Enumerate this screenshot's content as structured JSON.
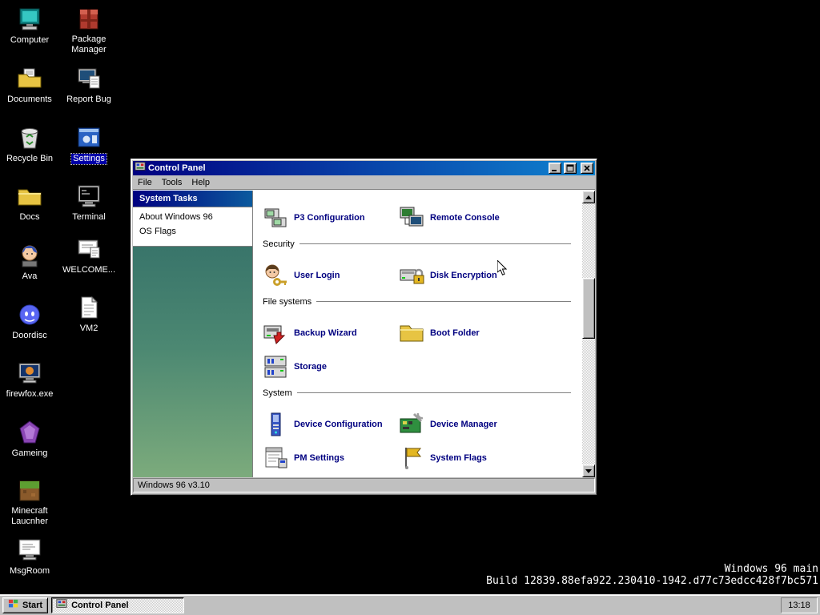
{
  "desktop": {
    "col1": [
      {
        "label": "Computer"
      },
      {
        "label": "Documents"
      },
      {
        "label": "Recycle Bin"
      },
      {
        "label": "Docs"
      },
      {
        "label": "Ava"
      },
      {
        "label": "Doordisc"
      },
      {
        "label": "firewfox.exe"
      },
      {
        "label": "Gameing"
      },
      {
        "label": "Minecraft Laucnher"
      },
      {
        "label": "MsgRoom"
      }
    ],
    "col2": [
      {
        "label": "Package Manager"
      },
      {
        "label": "Report Bug"
      },
      {
        "label": "Settings"
      },
      {
        "label": "Terminal"
      },
      {
        "label": "WELCOME..."
      },
      {
        "label": "VM2"
      }
    ],
    "build_line1": "Windows 96 main",
    "build_line2": "Build 12839.88efa922.230410-1942.d77c73edcc428f7bc571"
  },
  "window": {
    "title": "Control Panel",
    "menu": [
      {
        "label": "File"
      },
      {
        "label": "Tools"
      },
      {
        "label": "Help"
      }
    ],
    "sidebar": {
      "header": "System Tasks",
      "links": [
        {
          "label": "About Windows 96"
        },
        {
          "label": "OS Flags"
        }
      ]
    },
    "sections": [
      {
        "header": "",
        "items": [
          {
            "label": "P3 Configuration",
            "icon": "p3-configuration-icon"
          },
          {
            "label": "Remote Console",
            "icon": "remote-console-icon"
          }
        ]
      },
      {
        "header": "Security",
        "items": [
          {
            "label": "User Login",
            "icon": "user-login-icon"
          },
          {
            "label": "Disk Encryption",
            "icon": "disk-encryption-icon"
          }
        ]
      },
      {
        "header": "File systems",
        "items": [
          {
            "label": "Backup Wizard",
            "icon": "backup-wizard-icon"
          },
          {
            "label": "Boot Folder",
            "icon": "boot-folder-icon"
          },
          {
            "label": "Storage",
            "icon": "storage-icon"
          }
        ]
      },
      {
        "header": "System",
        "items": [
          {
            "label": "Device Configuration",
            "icon": "device-configuration-icon"
          },
          {
            "label": "Device Manager",
            "icon": "device-manager-icon"
          },
          {
            "label": "PM Settings",
            "icon": "pm-settings-icon"
          },
          {
            "label": "System Flags",
            "icon": "system-flags-icon"
          }
        ]
      }
    ],
    "status": "Windows 96 v3.10"
  },
  "taskbar": {
    "start_label": "Start",
    "task_label": "Control Panel",
    "clock": "13:18"
  },
  "colors": {
    "titlebar_left": "#000080",
    "titlebar_right": "#1084d0",
    "sidebar_top": "#2e6a66",
    "sidebar_bottom": "#7cab7c",
    "item_label": "#000080",
    "selection": "#0000a8",
    "chrome": "#c0c0c0"
  }
}
